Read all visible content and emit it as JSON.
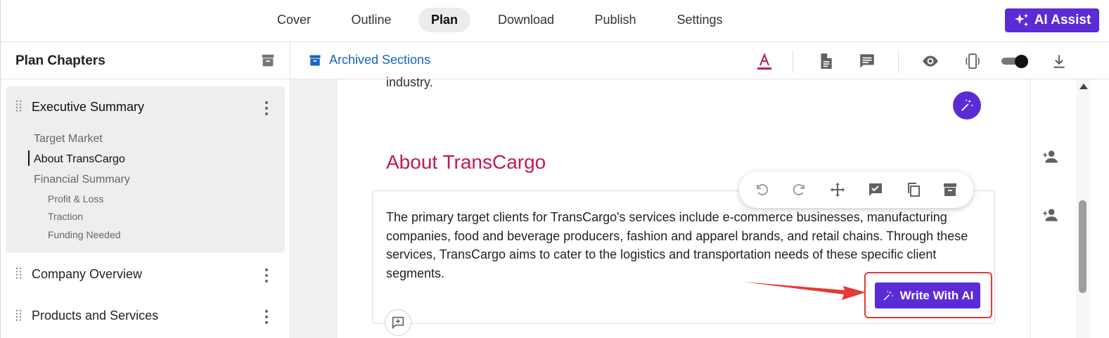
{
  "nav": {
    "tabs": [
      {
        "label": "Cover"
      },
      {
        "label": "Outline"
      },
      {
        "label": "Plan"
      },
      {
        "label": "Download"
      },
      {
        "label": "Publish"
      },
      {
        "label": "Settings"
      }
    ],
    "active_tab": "Plan",
    "ai_assist_label": "AI Assist"
  },
  "sidebar": {
    "title": "Plan Chapters",
    "chapters": [
      {
        "title": "Executive Summary",
        "sections": [
          "Target Market",
          "About TransCargo",
          "Financial Summary"
        ],
        "subsections": [
          "Profit & Loss",
          "Traction",
          "Funding Needed"
        ]
      },
      {
        "title": "Company Overview"
      },
      {
        "title": "Products and Services"
      }
    ],
    "current_section": "About TransCargo"
  },
  "toolbar": {
    "archived_label": "Archived Sections"
  },
  "editor": {
    "previous_text_tail": "industry.",
    "section_heading": "About TransCargo",
    "body": "The primary target clients for TransCargo's services include e-commerce businesses, manufacturing companies, food and beverage producers, fashion and apparel brands, and retail chains. Through these services, TransCargo aims to cater to the logistics and transportation needs of these specific client segments.",
    "write_with_ai_label": "Write With AI"
  },
  "colors": {
    "accent": "#5b2bd6",
    "heading": "#c2185b",
    "link": "#1565c0",
    "highlight": "#e53935"
  },
  "icons": [
    "sparkle-icon",
    "archive-icon",
    "text-color-icon",
    "document-icon",
    "comment-icon",
    "eye-icon",
    "device-icon",
    "download-icon",
    "undo-icon",
    "redo-icon",
    "move-icon",
    "approve-icon",
    "copy-icon",
    "magic-wand-icon",
    "add-person-icon",
    "add-comment-icon"
  ]
}
